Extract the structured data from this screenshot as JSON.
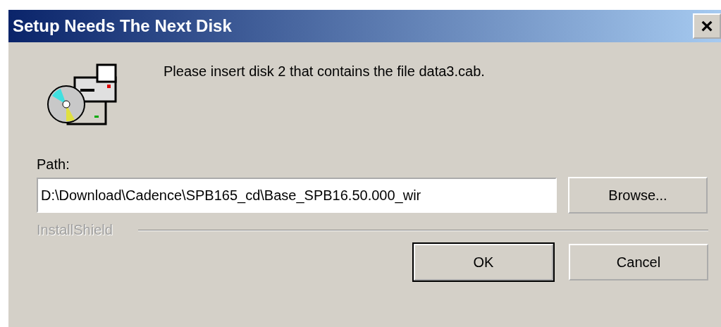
{
  "window": {
    "title": "Setup Needs The Next Disk",
    "close": "×"
  },
  "message": "Please insert disk 2 that contains the file data3.cab.",
  "path": {
    "label": "Path:",
    "value": "D:\\Download\\Cadence\\SPB165_cd\\Base_SPB16.50.000_wir"
  },
  "brand": "InstallShield",
  "buttons": [
    {
      "label": "Browse...",
      "default": false
    },
    {
      "label": "OK",
      "default": true
    },
    {
      "label": "Cancel",
      "default": false
    }
  ]
}
